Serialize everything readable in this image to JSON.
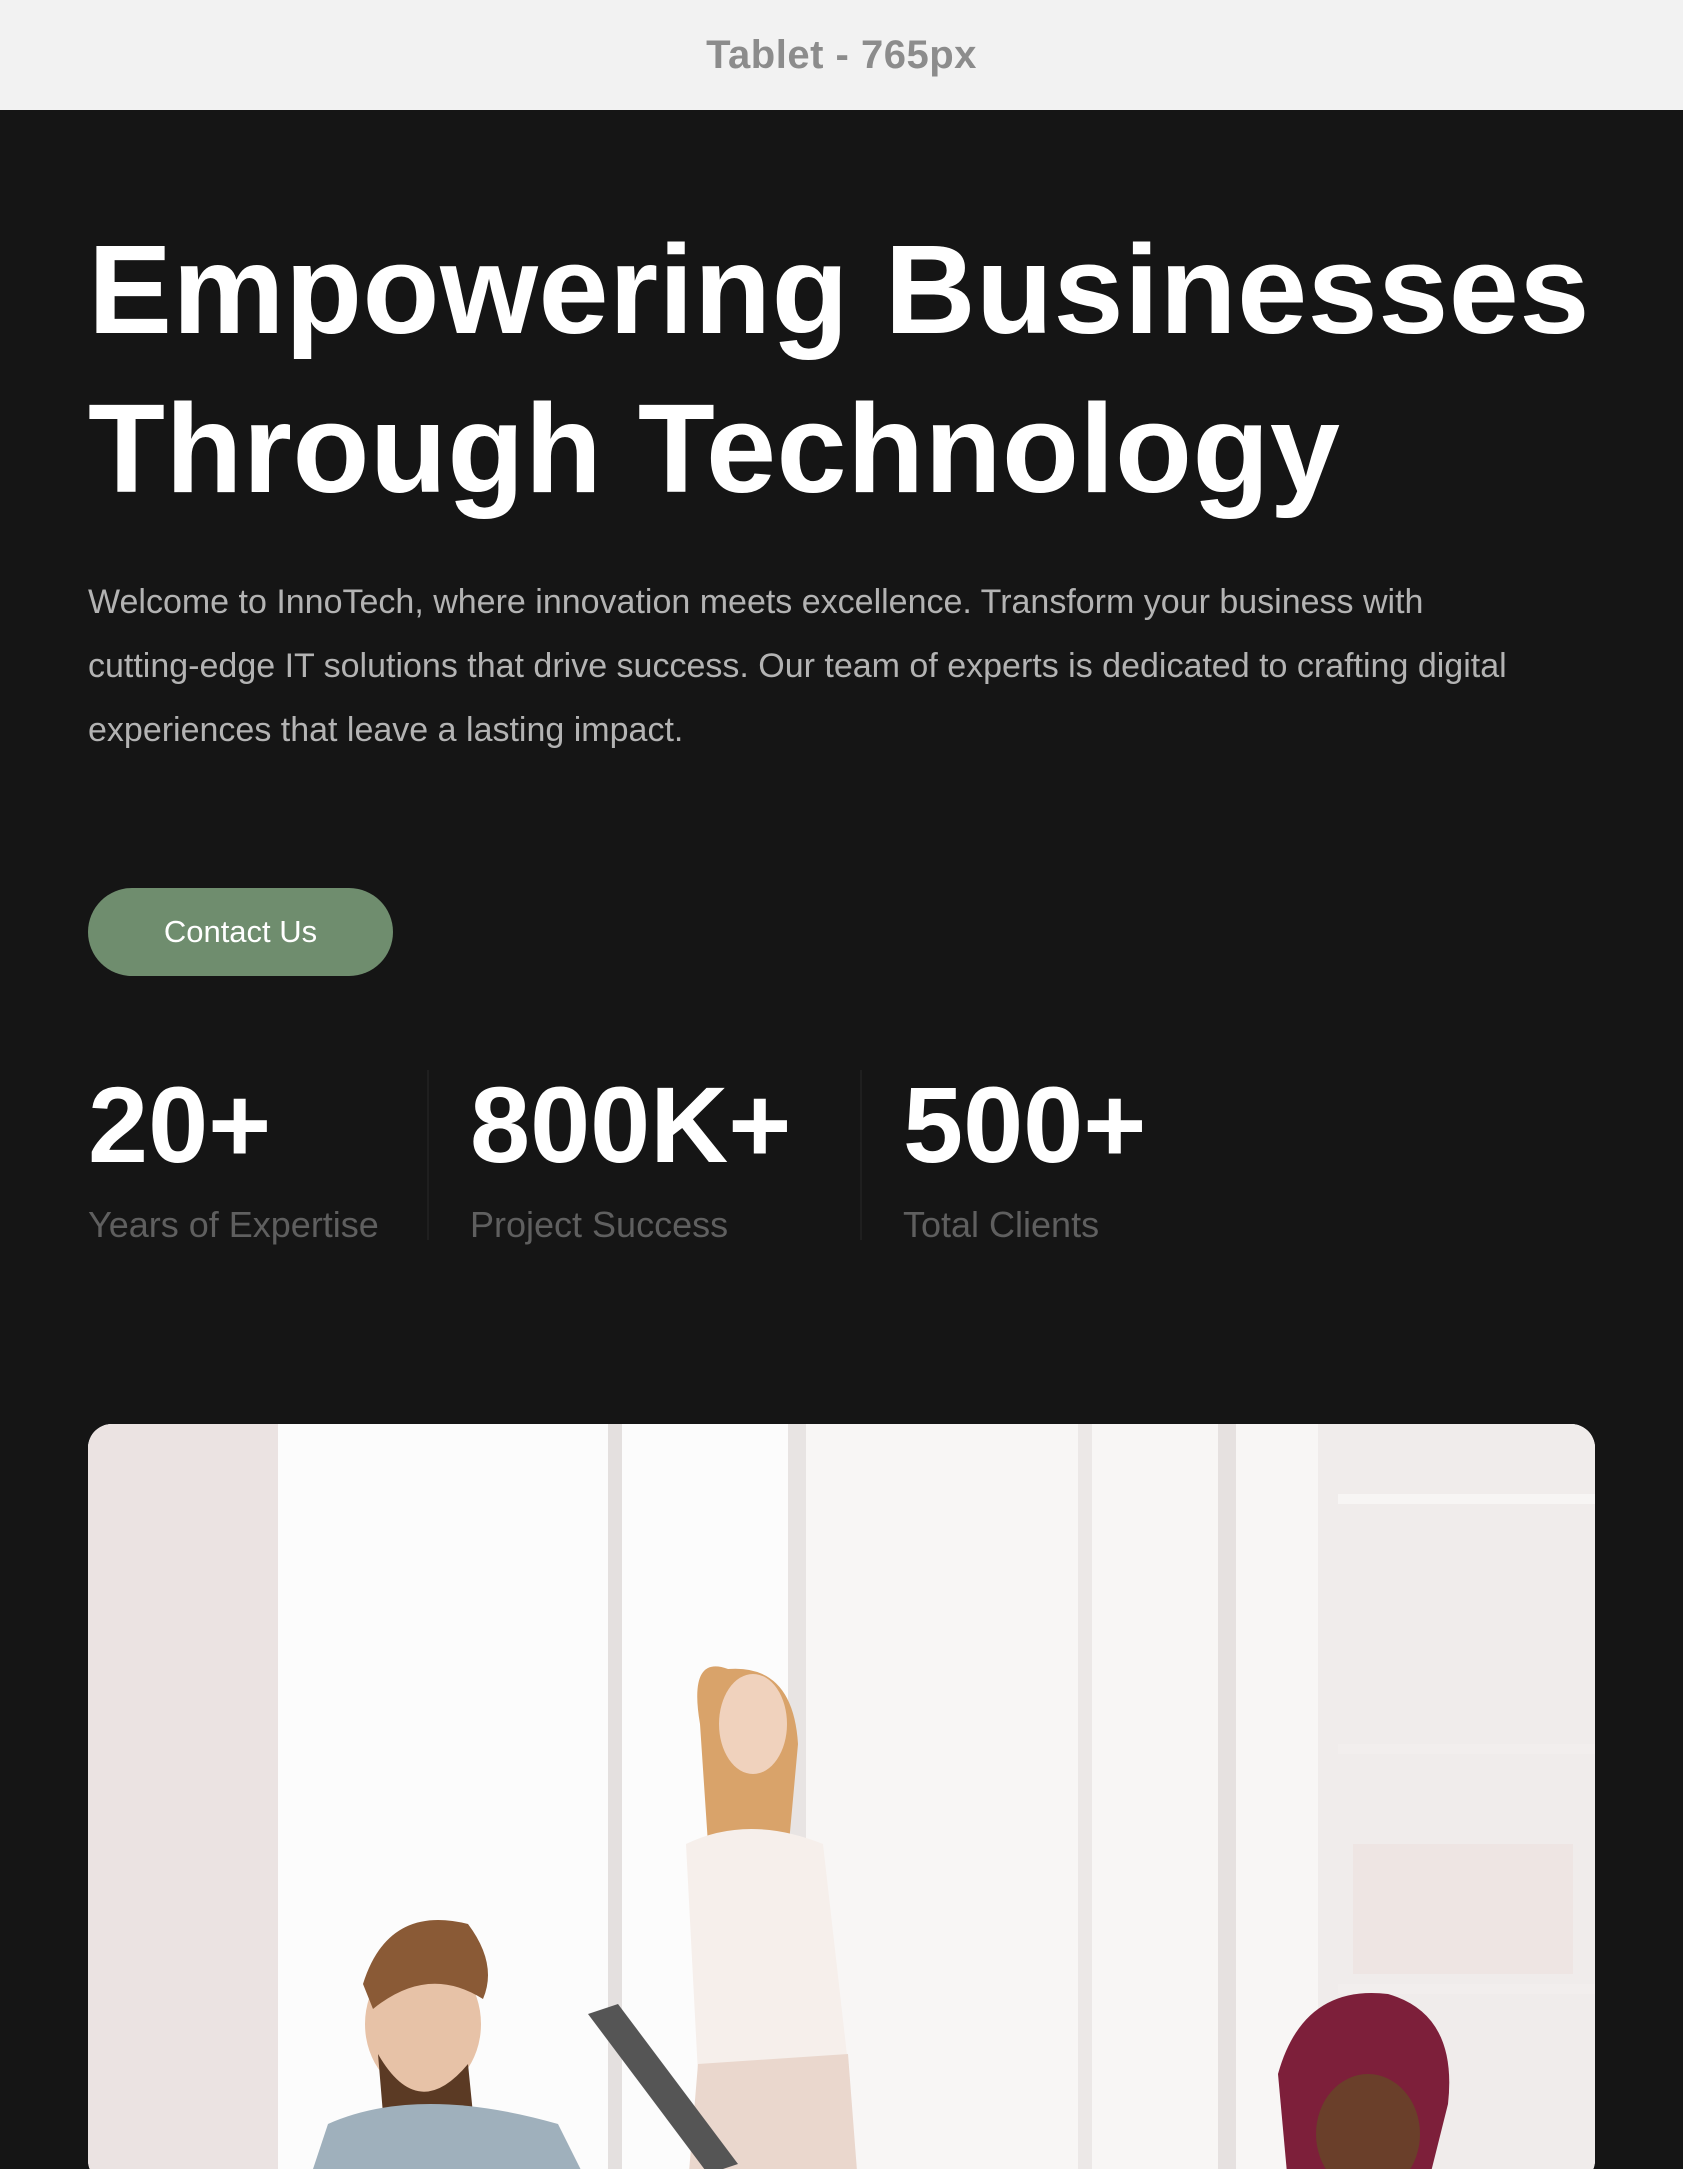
{
  "viewport_label": "Tablet - 765px",
  "hero": {
    "title_line1": "Empowering Businesses",
    "title_line2": "Through Technology",
    "description": "Welcome to InnoTech, where innovation meets excellence. Transform your business with cutting-edge IT solutions that drive success. Our team of experts is dedicated to crafting digital experiences that leave a lasting impact.",
    "cta_label": "Contact Us"
  },
  "stats": [
    {
      "value": "20+",
      "label": "Years of Expertise"
    },
    {
      "value": "800K+",
      "label": "Project Success"
    },
    {
      "value": "500+",
      "label": "Total Clients"
    }
  ],
  "colors": {
    "background": "#151515",
    "accent": "#6f8d6e",
    "heading": "#ffffff",
    "body_text": "#b3b3b3",
    "muted_text": "#5f5f5f"
  }
}
